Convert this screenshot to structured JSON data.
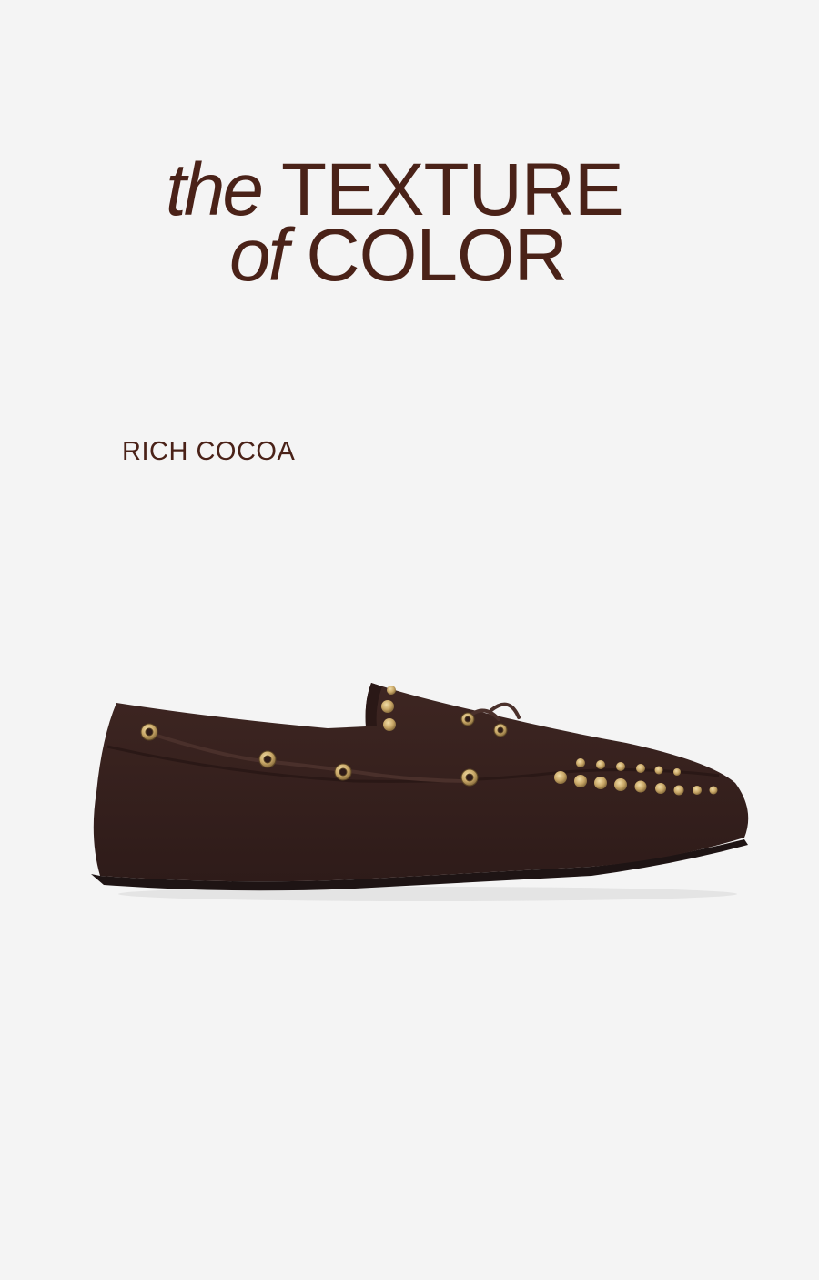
{
  "headline": {
    "line1_italic": "the",
    "line1_caps": "TEXTURE",
    "line2_italic": "of",
    "line2_caps": "COLOR"
  },
  "color_name": "RICH COCOA",
  "product_image": {
    "icon": "loafer-shoe-image",
    "suede_color": "#3a2320",
    "stud_color": "#c9a868"
  },
  "colors": {
    "background": "#f4f4f4",
    "text": "#4a2218"
  }
}
